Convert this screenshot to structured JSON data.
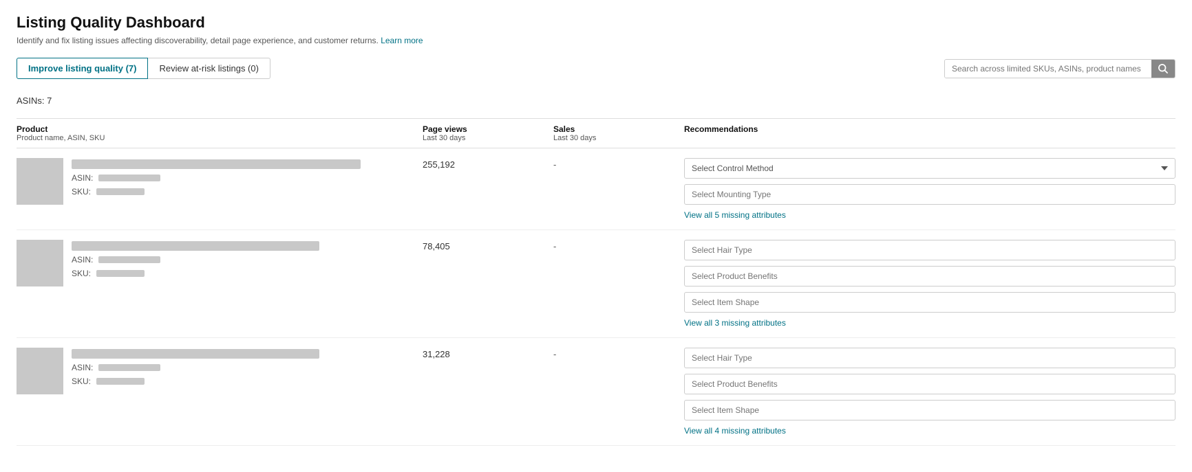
{
  "page": {
    "title": "Listing Quality Dashboard",
    "subtitle": "Identify and fix listing issues affecting discoverability, detail page experience, and customer returns.",
    "learn_more": "Learn more"
  },
  "tabs": [
    {
      "id": "improve",
      "label": "Improve listing quality (7)",
      "active": true
    },
    {
      "id": "review",
      "label": "Review at-risk listings (0)",
      "active": false
    }
  ],
  "search": {
    "placeholder": "Search across limited SKUs, ASINs, product names"
  },
  "asin_count": "ASINs: 7",
  "columns": {
    "product": {
      "label": "Product",
      "sub": "Product name, ASIN, SKU"
    },
    "page_views": {
      "label": "Page views",
      "sub": "Last 30 days"
    },
    "sales": {
      "label": "Sales",
      "sub": "Last 30 days"
    },
    "recommendations": {
      "label": "Recommendations"
    }
  },
  "rows": [
    {
      "id": "row1",
      "page_views": "255,192",
      "sales": "-",
      "asin_label": "ASIN:",
      "sku_label": "SKU:",
      "recommendations": [
        {
          "type": "dropdown",
          "placeholder": "Select Control Method"
        },
        {
          "type": "input",
          "placeholder": "Select Mounting Type"
        }
      ],
      "view_missing": "View all 5 missing attributes"
    },
    {
      "id": "row2",
      "page_views": "78,405",
      "sales": "-",
      "asin_label": "ASIN:",
      "sku_label": "SKU:",
      "recommendations": [
        {
          "type": "input",
          "placeholder": "Select Hair Type"
        },
        {
          "type": "input",
          "placeholder": "Select Product Benefits"
        },
        {
          "type": "input",
          "placeholder": "Select Item Shape"
        }
      ],
      "view_missing": "View all 3 missing attributes"
    },
    {
      "id": "row3",
      "page_views": "31,228",
      "sales": "-",
      "asin_label": "ASIN:",
      "sku_label": "SKU:",
      "recommendations": [
        {
          "type": "input",
          "placeholder": "Select Hair Type"
        },
        {
          "type": "input",
          "placeholder": "Select Product Benefits"
        },
        {
          "type": "input",
          "placeholder": "Select Item Shape"
        }
      ],
      "view_missing": "View all 4 missing attributes"
    }
  ]
}
